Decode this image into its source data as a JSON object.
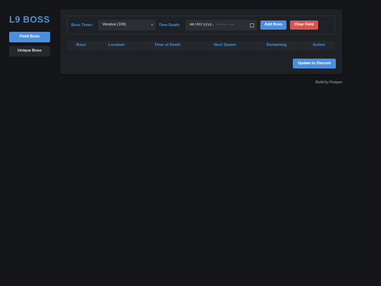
{
  "sidebar": {
    "logo": "L9 BOSS",
    "items": [
      {
        "label": "Field Boss",
        "active": true
      },
      {
        "label": "Unique Boss",
        "active": false
      }
    ]
  },
  "form": {
    "boss_timer_label": "Boss Timer:",
    "boss_select_value": "Venatus (10h)",
    "time_death_label": "Time Death:",
    "time_death_placeholder": "mm/dd/yyyy, --:-- --",
    "add_button": "Add Boss",
    "clear_button": "Clear Field"
  },
  "table": {
    "columns": [
      "Boss",
      "Location",
      "Time of Death",
      "Next Spawn",
      "Remaining",
      "Action"
    ],
    "rows": []
  },
  "update_button": "Update to Discord",
  "footer": "Build by Punpun",
  "colors": {
    "accent": "#4a90e2",
    "danger": "#d9534f",
    "background": "#14161a",
    "card": "#1e2125"
  }
}
